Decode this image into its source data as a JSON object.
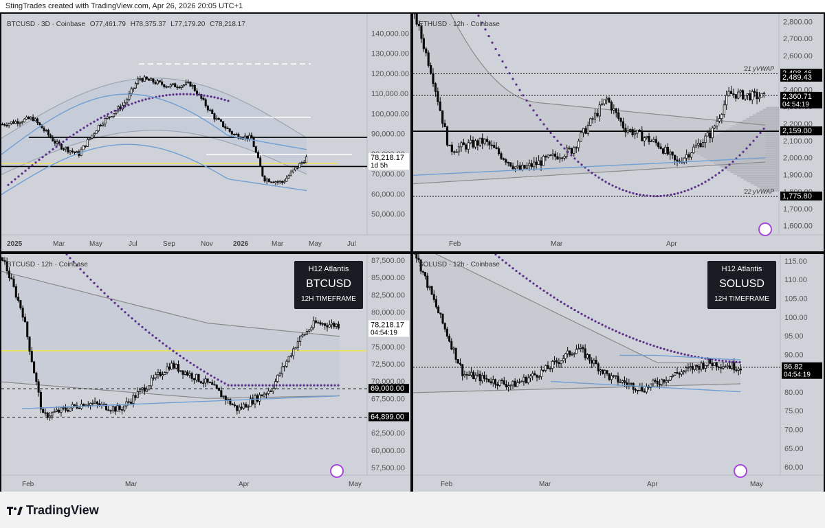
{
  "header": {
    "text": "StingTrades created with TradingView.com, Apr 26, 2026 20:05 UTC+1"
  },
  "footer": {
    "brand": "TradingView"
  },
  "colors": {
    "bg": "#d0d2d9",
    "candle": "#0b0b0b",
    "band": "#6f9fd4",
    "vwap": "#5a2f8a",
    "dots": "#5a2f8a",
    "yellow": "#f2e44a",
    "gray": "#808080"
  },
  "panels": [
    {
      "id": "btc3d",
      "header": {
        "symbol": "BTCUSD · 3D · Coinbase",
        "o": "O77,461.79",
        "h": "H78,375.37",
        "l": "L77,179.20",
        "c": "C78,218.17"
      },
      "badge": null,
      "price_axis": [
        "140,000.00",
        "130,000.00",
        "120,000.00",
        "110,000.00",
        "100,000.00",
        "90,000.00",
        "80,000.00",
        "70,000.00",
        "60,000.00",
        "50,000.00"
      ],
      "price_tag": {
        "value": "78,218.17",
        "sub": "1d 5h"
      },
      "time_axis": [
        "2025",
        "Mar",
        "May",
        "Jul",
        "Sep",
        "Nov",
        "2026",
        "Mar",
        "May",
        "Jul"
      ]
    },
    {
      "id": "eth12h",
      "header": {
        "symbol": "ETHUSD · 12h · Coinbase"
      },
      "badge": null,
      "price_axis": [
        "2,800.00",
        "2,700.00",
        "2,600.00",
        "2,500.00",
        "2,400.00",
        "2,300.00",
        "2,200.00",
        "2,100.00",
        "2,000.00",
        "1,900.00",
        "1,800.00",
        "1,700.00",
        "1,600.00"
      ],
      "levels": [
        {
          "label": "'21 yVWAP",
          "value": "2,498.46"
        },
        {
          "label": "",
          "value": "2,489.43"
        },
        {
          "label": "",
          "value": "2,360.71",
          "sub": "04:54:19"
        },
        {
          "label": "",
          "value": "2,159.00"
        },
        {
          "label": "'22 yVWAP",
          "value": "1,775.80"
        }
      ],
      "time_axis": [
        "Feb",
        "Mar",
        "Apr"
      ]
    },
    {
      "id": "btc12h",
      "header": {
        "symbol": "BTCUSD · 12h · Coinbase"
      },
      "badge": {
        "line1": "H12 Atlantis",
        "line2": "BTCUSD",
        "line3": "12H TIMEFRAME"
      },
      "price_axis": [
        "87,500.00",
        "85,000.00",
        "82,500.00",
        "80,000.00",
        "77,500.00",
        "75,000.00",
        "72,500.00",
        "70,000.00",
        "67,500.00",
        "65,000.00",
        "62,500.00",
        "60,000.00",
        "57,500.00"
      ],
      "levels": [
        {
          "value": "78,218.17",
          "sub": "04:54:19"
        },
        {
          "value": "69,000.00"
        },
        {
          "value": "64,899.00"
        }
      ],
      "time_axis": [
        "Feb",
        "Mar",
        "Apr",
        "May"
      ]
    },
    {
      "id": "sol12h",
      "header": {
        "symbol": "SOLUSD · 12h · Coinbase"
      },
      "badge": {
        "line1": "H12 Atlantis",
        "line2": "SOLUSD",
        "line3": "12H TIMEFRAME"
      },
      "price_axis": [
        "115.00",
        "110.00",
        "105.00",
        "100.00",
        "95.00",
        "90.00",
        "85.00",
        "80.00",
        "75.00",
        "70.00",
        "65.00",
        "60.00"
      ],
      "levels": [
        {
          "value": "86.82",
          "sub": "04:54:19"
        }
      ],
      "time_axis": [
        "Feb",
        "Mar",
        "Apr",
        "May"
      ]
    }
  ],
  "chart_data": [
    {
      "type": "line",
      "title": "BTCUSD · 3D · Coinbase",
      "x": [
        "2025",
        "Mar",
        "May",
        "Jul",
        "Sep",
        "Nov",
        "2026",
        "Mar",
        "May"
      ],
      "series": [
        {
          "values": [
            93000,
            85000,
            95000,
            110000,
            115000,
            108000,
            88000,
            68000,
            78218
          ]
        }
      ],
      "ylim": [
        40000,
        150000
      ]
    },
    {
      "type": "line",
      "title": "ETHUSD · 12h · Coinbase",
      "x": [
        "Feb",
        "Mar",
        "Apr"
      ],
      "series": [
        {
          "values": [
            2750,
            2050,
            2100,
            2360
          ]
        }
      ],
      "ylim": [
        1550,
        2850
      ]
    },
    {
      "type": "line",
      "title": "BTCUSD · 12h · Coinbase",
      "x": [
        "Feb",
        "Mar",
        "Apr",
        "May"
      ],
      "series": [
        {
          "values": [
            83000,
            66000,
            72000,
            78218
          ]
        }
      ],
      "ylim": [
        56500,
        88500
      ]
    },
    {
      "type": "line",
      "title": "SOLUSD · 12h · Coinbase",
      "x": [
        "Feb",
        "Mar",
        "Apr",
        "May"
      ],
      "series": [
        {
          "values": [
            116,
            84,
            85,
            86.82
          ]
        }
      ],
      "ylim": [
        58,
        117
      ]
    }
  ]
}
